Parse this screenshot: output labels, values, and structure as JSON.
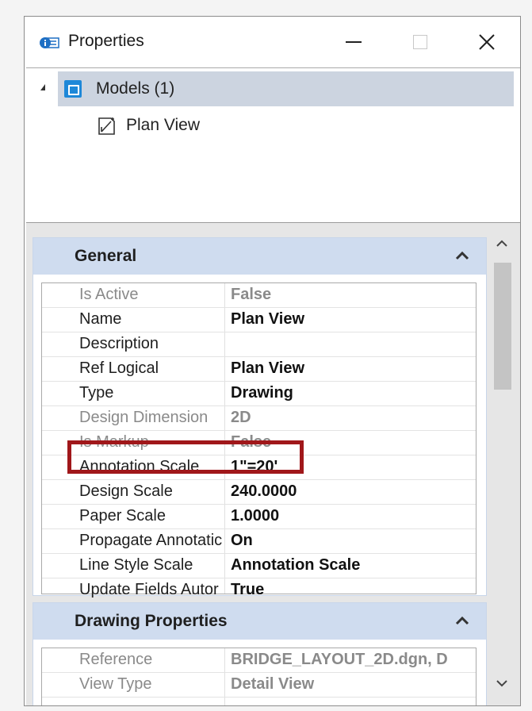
{
  "window": {
    "title": "Properties"
  },
  "tree": {
    "models_label": "Models (1)",
    "plan_view_label": "Plan View"
  },
  "groups": [
    {
      "title": "General",
      "rows": [
        {
          "name": "Is Active",
          "value": "False",
          "dim": true
        },
        {
          "name": "Name",
          "value": "Plan View",
          "dim": false
        },
        {
          "name": "Description",
          "value": "",
          "dim": false
        },
        {
          "name": "Ref Logical",
          "value": "Plan View",
          "dim": false
        },
        {
          "name": "Type",
          "value": "Drawing",
          "dim": false
        },
        {
          "name": "Design Dimension",
          "value": "2D",
          "dim": true
        },
        {
          "name": "Is Markup",
          "value": "False",
          "dim": true
        },
        {
          "name": "Annotation Scale",
          "value": "1\"=20'",
          "dim": false
        },
        {
          "name": "Design Scale",
          "value": "240.0000",
          "dim": false
        },
        {
          "name": "Paper Scale",
          "value": "1.0000",
          "dim": false
        },
        {
          "name": "Propagate Annotatic",
          "value": "On",
          "dim": false
        },
        {
          "name": "Line Style Scale",
          "value": "Annotation Scale",
          "dim": false
        },
        {
          "name": "Update Fields Autor",
          "value": "True",
          "dim": false
        }
      ]
    },
    {
      "title": "Drawing Properties",
      "rows": [
        {
          "name": "Reference",
          "value": "BRIDGE_LAYOUT_2D.dgn, D",
          "dim": true
        },
        {
          "name": "View Type",
          "value": "Detail View",
          "dim": true
        }
      ]
    }
  ],
  "icons": {
    "app": "properties-icon",
    "models": "models-icon",
    "plan_view": "drawing-model-icon"
  },
  "colors": {
    "header_bg": "#cfdcef",
    "selection_bg": "#ccd4e0",
    "highlight": "#a0171a",
    "accent": "#1e88d8"
  }
}
